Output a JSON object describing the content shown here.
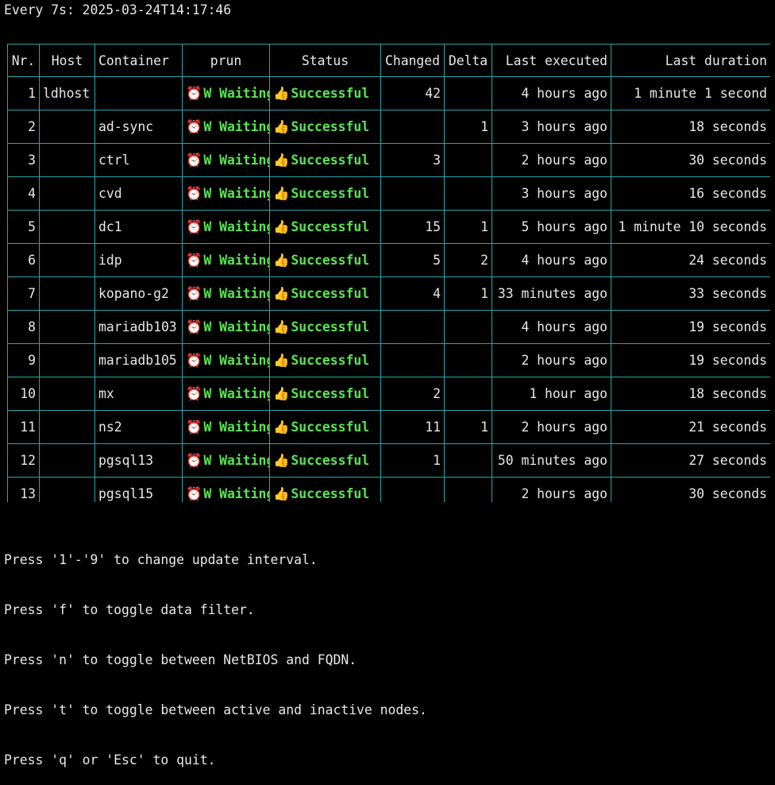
{
  "header": {
    "text": "Every 7s: 2025-03-24T14:17:46"
  },
  "table": {
    "columns": [
      "Nr.",
      "Host",
      "Container",
      "prun",
      "Status",
      "Changed",
      "Delta",
      "Last executed",
      "Last duration"
    ],
    "rows": [
      {
        "nr": "1",
        "host": "ldhost",
        "container": "",
        "prun_icon": "⏰",
        "prun": "W Waiting",
        "status_icon": "👍",
        "status": "Successful",
        "changed": "42",
        "delta": "",
        "last_executed": "4 hours ago",
        "last_duration": "1 minute 1 second"
      },
      {
        "nr": "2",
        "host": "",
        "container": "ad-sync",
        "prun_icon": "⏰",
        "prun": "W Waiting",
        "status_icon": "👍",
        "status": "Successful",
        "changed": "",
        "delta": "1",
        "last_executed": "3 hours ago",
        "last_duration": "18 seconds"
      },
      {
        "nr": "3",
        "host": "",
        "container": "ctrl",
        "prun_icon": "⏰",
        "prun": "W Waiting",
        "status_icon": "👍",
        "status": "Successful",
        "changed": "3",
        "delta": "",
        "last_executed": "2 hours ago",
        "last_duration": "30 seconds"
      },
      {
        "nr": "4",
        "host": "",
        "container": "cvd",
        "prun_icon": "⏰",
        "prun": "W Waiting",
        "status_icon": "👍",
        "status": "Successful",
        "changed": "",
        "delta": "",
        "last_executed": "3 hours ago",
        "last_duration": "16 seconds"
      },
      {
        "nr": "5",
        "host": "",
        "container": "dc1",
        "prun_icon": "⏰",
        "prun": "W Waiting",
        "status_icon": "👍",
        "status": "Successful",
        "changed": "15",
        "delta": "1",
        "last_executed": "5 hours ago",
        "last_duration": "1 minute 10 seconds"
      },
      {
        "nr": "6",
        "host": "",
        "container": "idp",
        "prun_icon": "⏰",
        "prun": "W Waiting",
        "status_icon": "👍",
        "status": "Successful",
        "changed": "5",
        "delta": "2",
        "last_executed": "4 hours ago",
        "last_duration": "24 seconds"
      },
      {
        "nr": "7",
        "host": "",
        "container": "kopano-g2",
        "prun_icon": "⏰",
        "prun": "W Waiting",
        "status_icon": "👍",
        "status": "Successful",
        "changed": "4",
        "delta": "1",
        "last_executed": "33 minutes ago",
        "last_duration": "33 seconds"
      },
      {
        "nr": "8",
        "host": "",
        "container": "mariadb103",
        "prun_icon": "⏰",
        "prun": "W Waiting",
        "status_icon": "👍",
        "status": "Successful",
        "changed": "",
        "delta": "",
        "last_executed": "4 hours ago",
        "last_duration": "19 seconds"
      },
      {
        "nr": "9",
        "host": "",
        "container": "mariadb105",
        "prun_icon": "⏰",
        "prun": "W Waiting",
        "status_icon": "👍",
        "status": "Successful",
        "changed": "",
        "delta": "",
        "last_executed": "2 hours ago",
        "last_duration": "19 seconds"
      },
      {
        "nr": "10",
        "host": "",
        "container": "mx",
        "prun_icon": "⏰",
        "prun": "W Waiting",
        "status_icon": "👍",
        "status": "Successful",
        "changed": "2",
        "delta": "",
        "last_executed": "1 hour ago",
        "last_duration": "18 seconds"
      },
      {
        "nr": "11",
        "host": "",
        "container": "ns2",
        "prun_icon": "⏰",
        "prun": "W Waiting",
        "status_icon": "👍",
        "status": "Successful",
        "changed": "11",
        "delta": "1",
        "last_executed": "2 hours ago",
        "last_duration": "21 seconds"
      },
      {
        "nr": "12",
        "host": "",
        "container": "pgsql13",
        "prun_icon": "⏰",
        "prun": "W Waiting",
        "status_icon": "👍",
        "status": "Successful",
        "changed": "1",
        "delta": "",
        "last_executed": "50 minutes ago",
        "last_duration": "27 seconds"
      },
      {
        "nr": "13",
        "host": "",
        "container": "pgsql15",
        "prun_icon": "⏰",
        "prun": "W Waiting",
        "status_icon": "👍",
        "status": "Successful",
        "changed": "",
        "delta": "",
        "last_executed": "2 hours ago",
        "last_duration": "30 seconds"
      }
    ]
  },
  "footer": {
    "lines": [
      "Press '1'-'9' to change update interval.",
      "Press 'f' to toggle data filter.",
      "Press 'n' to toggle between NetBIOS and FQDN.",
      "Press 't' to toggle between active and inactive nodes.",
      "Press 'q' or 'Esc' to quit."
    ]
  },
  "colors": {
    "background": "#000000",
    "text": "#e8e8e8",
    "grid": "#2aa6ad",
    "status_green": "#57e64f"
  },
  "icons": {
    "prun": "alarm-clock-icon",
    "status": "thumbs-up-icon"
  }
}
